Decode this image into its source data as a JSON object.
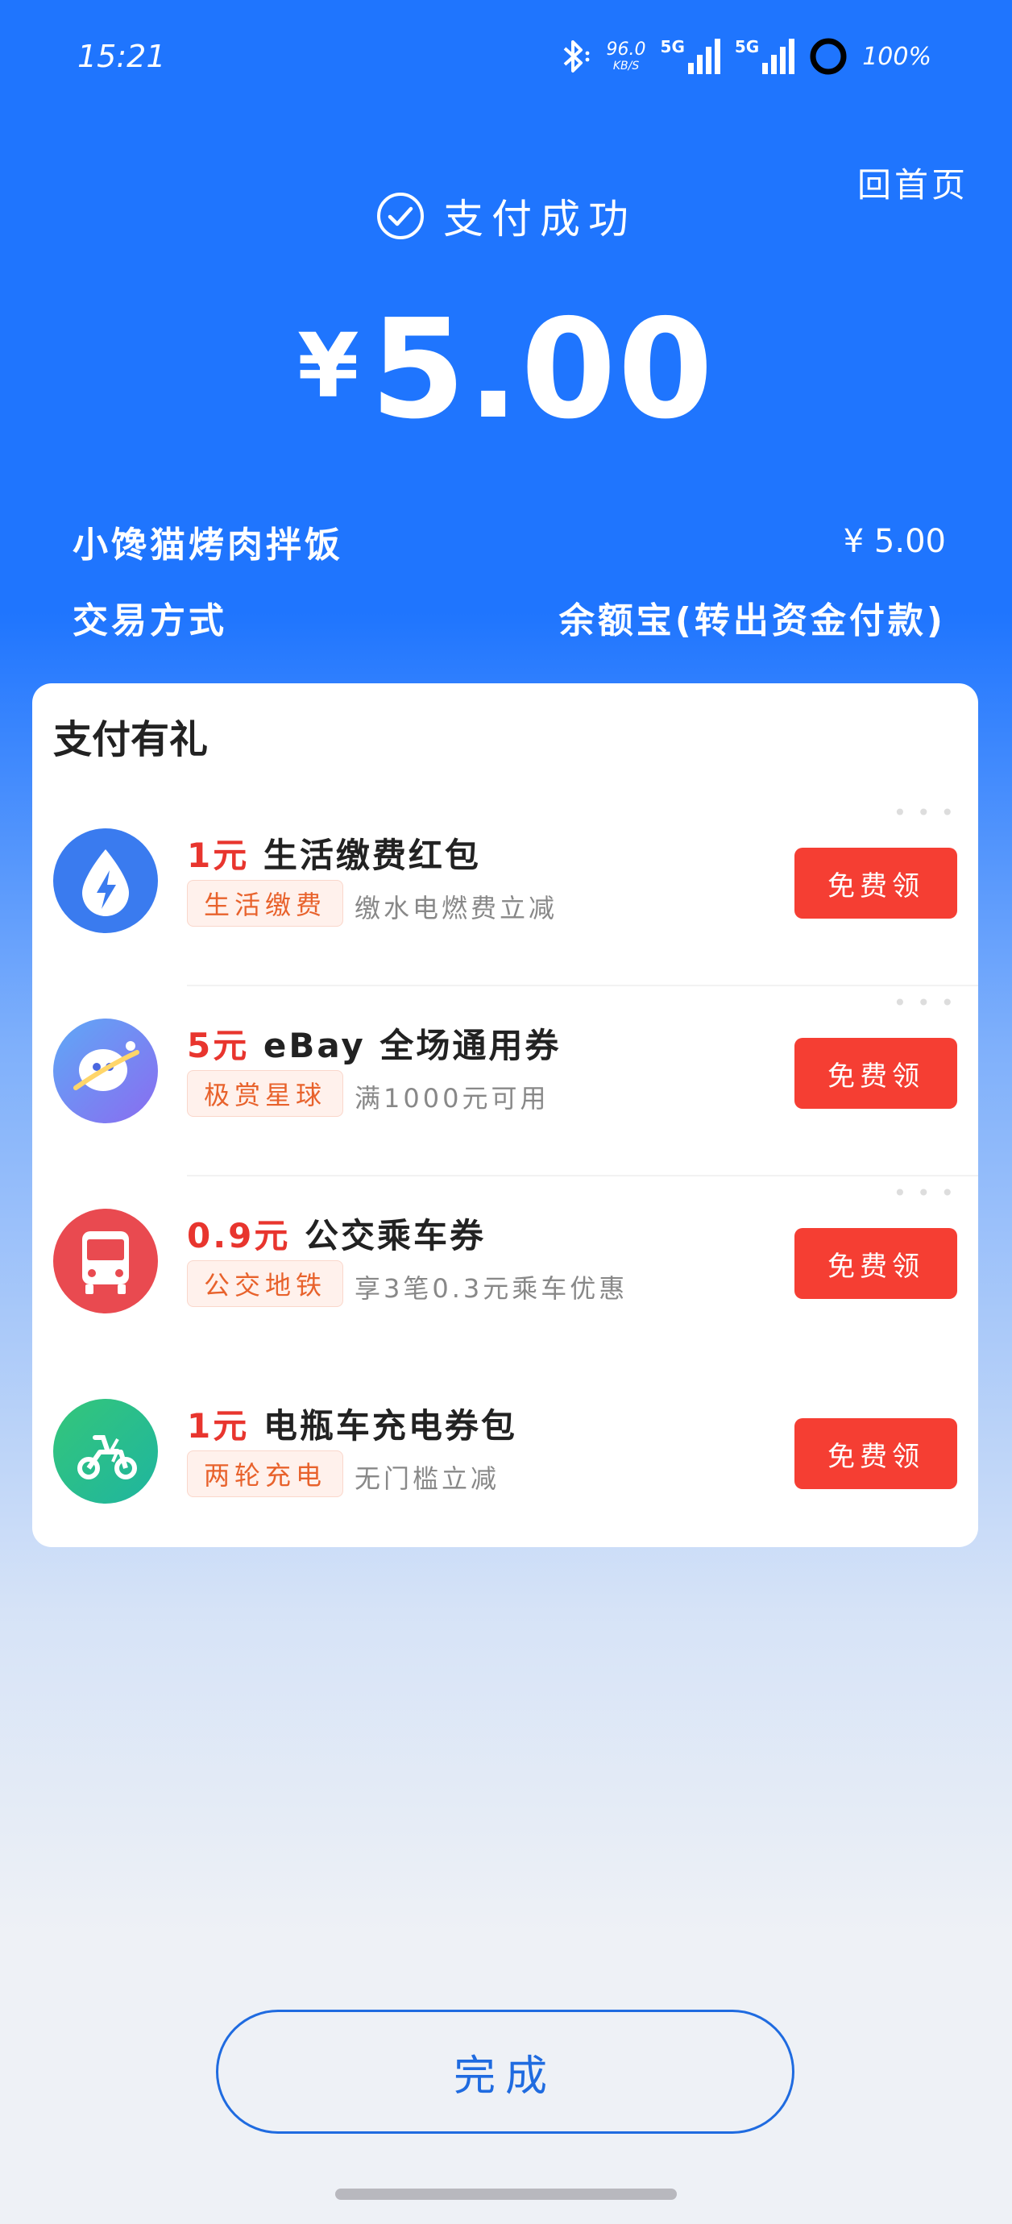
{
  "status_bar": {
    "time": "15:21",
    "net_speed_value": "96.0",
    "net_speed_unit": "KB/S",
    "signal1_label": "5G",
    "signal2_label": "5G",
    "battery": "100%"
  },
  "header": {
    "home_link": "回首页",
    "status_text": "支付成功",
    "amount_currency": "¥",
    "amount_value": "5.00"
  },
  "details": {
    "merchant_name": "小馋猫烤肉拌饭",
    "merchant_amount": "¥ 5.00",
    "method_label": "交易方式",
    "method_value": "余额宝(转出资金付款)"
  },
  "rewards": {
    "title": "支付有礼",
    "items": [
      {
        "price": "1元",
        "name": "生活缴费红包",
        "tag": "生活缴费",
        "desc": "缴水电燃费立减",
        "button": "免费领",
        "icon": "lightning-drop-icon",
        "color": "#3A7BEF"
      },
      {
        "price": "5元",
        "name": "eBay 全场通用券",
        "tag": "极赏星球",
        "desc": "满1000元可用",
        "button": "免费领",
        "icon": "planet-mascot-icon",
        "color": "#6C86F5"
      },
      {
        "price": "0.9元",
        "name": "公交乘车券",
        "tag": "公交地铁",
        "desc": "享3笔0.3元乘车优惠",
        "button": "免费领",
        "icon": "bus-icon",
        "color": "#E94A50"
      },
      {
        "price": "1元",
        "name": "电瓶车充电券包",
        "tag": "两轮充电",
        "desc": "无门槛立减",
        "button": "免费领",
        "icon": "e-scooter-icon",
        "color": "#2DBE6C"
      }
    ]
  },
  "footer": {
    "done_label": "完成"
  }
}
